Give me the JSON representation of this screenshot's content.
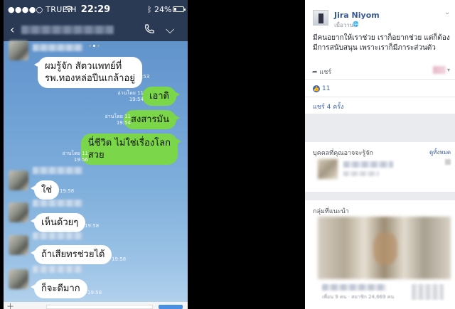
{
  "phone": {
    "status": {
      "carrier": "●●●●○ TRUE-H",
      "time": "22:29",
      "battery": "24%",
      "battery_level": 0.24,
      "wifi_icon": "wifi-icon",
      "bluetooth_icon": "bluetooth-icon"
    },
    "header": {
      "back": "‹",
      "chevron": "⌵"
    },
    "messages": [
      {
        "dir": "in",
        "text_lines": [
          "ผมรู้จัก สัตวแพทย์ที่",
          "รพ.ทองหล่อปีนเกล้าอยู่"
        ],
        "time": "19:53",
        "read": ""
      },
      {
        "dir": "out",
        "text_lines": [
          "เอาดิ"
        ],
        "time": "19:54",
        "read": "อ่านโดย 11"
      },
      {
        "dir": "out",
        "text_lines": [
          "สงสารมัน"
        ],
        "time": "19:54",
        "read": "อ่านโดย 11"
      },
      {
        "dir": "out",
        "text_lines": [
          "นี่ชีวิต ไม่ใช่เรื่องโลก",
          "สวย"
        ],
        "time": "19:56",
        "read": "อ่านโดย 11"
      },
      {
        "dir": "in",
        "text_lines": [
          "ใช่"
        ],
        "time": "19:58",
        "read": ""
      },
      {
        "dir": "in",
        "text_lines": [
          "เห็นด้วยๆ"
        ],
        "time": "19:58",
        "read": ""
      },
      {
        "dir": "in",
        "text_lines": [
          "ถ้าเสียทรช่วยได้"
        ],
        "time": "19:58",
        "read": ""
      },
      {
        "dir": "in",
        "text_lines": [
          "ก็จะดีมาก"
        ],
        "time": "19:58",
        "read": ""
      }
    ],
    "colors": {
      "outgoing": "#7bd64a",
      "incoming": "#ffffff",
      "header": "#2a3a55"
    }
  },
  "facebook": {
    "post": {
      "author": "Jira Niyom",
      "time": "เมื่อวานนี้",
      "text": "มีคนอยากให้เราช่วย เราก็อยากช่วย แต่ก็ต้องมีการสนับสนุน เพราะเราก็มีภาระส่วนตัว",
      "share_label": "แชร์",
      "like_count": "11",
      "shares_label": "แชร์ 4 ครั้ง"
    },
    "pymk": {
      "title": "บุคคลที่คุณอาจจะรู้จัก",
      "see_all": "ดูทั้งหมด"
    },
    "groups": {
      "title": "กลุ่มที่แนะนำ",
      "meta": "เพื่อน 9 คน · สมาชิก 24,669 คน"
    },
    "colors": {
      "link": "#365899",
      "like": "#4267b2"
    }
  }
}
